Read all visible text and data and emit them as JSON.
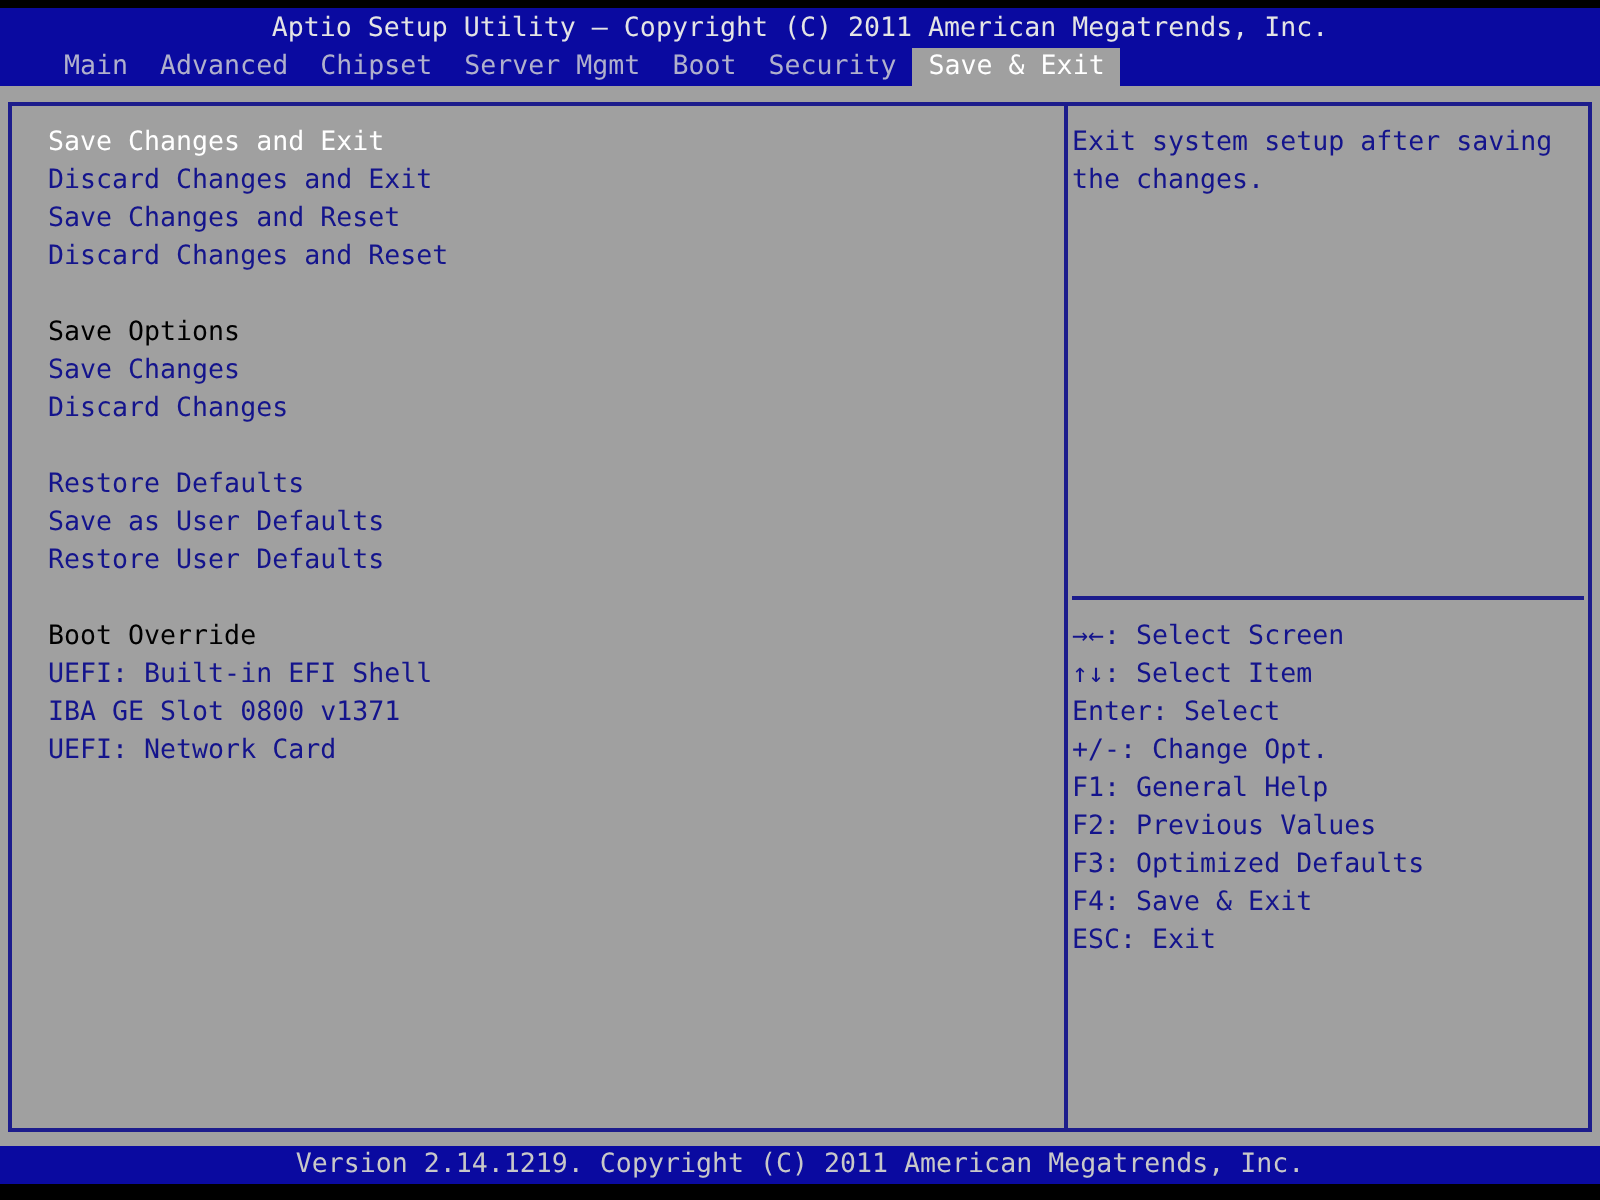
{
  "header": {
    "title": "Aptio Setup Utility – Copyright (C) 2011 American Megatrends, Inc."
  },
  "tabs": [
    {
      "label": "Main",
      "selected": false
    },
    {
      "label": "Advanced",
      "selected": false
    },
    {
      "label": "Chipset",
      "selected": false
    },
    {
      "label": "Server Mgmt",
      "selected": false
    },
    {
      "label": "Boot",
      "selected": false
    },
    {
      "label": "Security",
      "selected": false
    },
    {
      "label": "Save & Exit",
      "selected": true
    }
  ],
  "menu_groups": [
    {
      "options": [
        {
          "label": "Save Changes and Exit",
          "selected": true
        },
        {
          "label": "Discard Changes and Exit",
          "selected": false
        },
        {
          "label": "Save Changes and Reset",
          "selected": false
        },
        {
          "label": "Discard Changes and Reset",
          "selected": false
        }
      ]
    },
    {
      "heading": "Save Options",
      "options": [
        {
          "label": "Save Changes",
          "selected": false
        },
        {
          "label": "Discard Changes",
          "selected": false
        }
      ]
    },
    {
      "options": [
        {
          "label": "Restore Defaults",
          "selected": false
        },
        {
          "label": "Save as User Defaults",
          "selected": false
        },
        {
          "label": "Restore User Defaults",
          "selected": false
        }
      ]
    },
    {
      "heading": "Boot Override",
      "options": [
        {
          "label": "UEFI: Built-in EFI Shell",
          "selected": false
        },
        {
          "label": "IBA GE Slot 0800 v1371",
          "selected": false
        },
        {
          "label": "UEFI: Network Card",
          "selected": false
        }
      ]
    }
  ],
  "help": {
    "description": "Exit system setup after saving the changes.",
    "keys": [
      "→←: Select Screen",
      "↑↓: Select Item",
      "Enter: Select",
      "+/-: Change Opt.",
      "F1: General Help",
      "F2: Previous Values",
      "F3: Optimized Defaults",
      "F4: Save & Exit",
      "ESC: Exit"
    ]
  },
  "footer": {
    "text": "Version 2.14.1219. Copyright (C) 2011 American Megatrends, Inc."
  }
}
